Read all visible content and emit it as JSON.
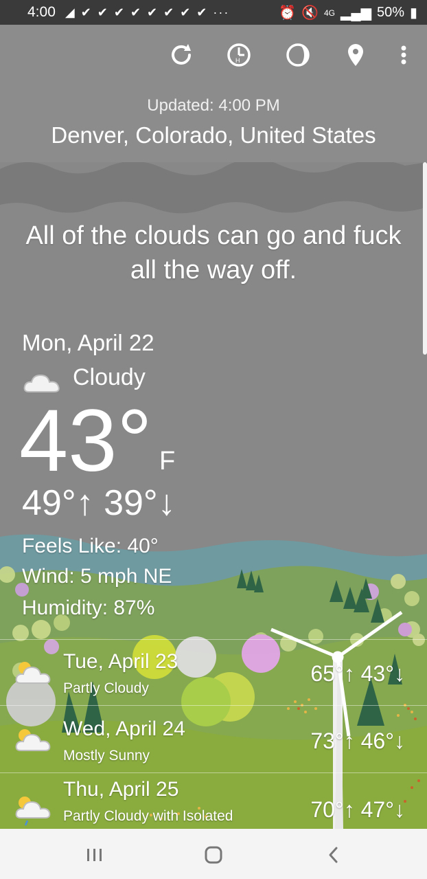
{
  "status_bar": {
    "time": "4:00",
    "network": "4G",
    "battery": "50%"
  },
  "toolbar": {
    "icons": [
      "refresh-icon",
      "history-icon",
      "moon-phase-icon",
      "location-pin-icon",
      "more-vert-icon"
    ]
  },
  "header": {
    "updated": "Updated: 4:00 PM",
    "location": "Denver, Colorado, United States"
  },
  "quote": "All of the clouds can go and fuck all the way off.",
  "current": {
    "date": "Mon, April 22",
    "condition": "Cloudy",
    "temp": "43°",
    "unit": "F",
    "hilo": "49°↑ 39°↓",
    "feels_like": "Feels Like: 40°",
    "wind": "Wind: 5 mph NE",
    "humidity": "Humidity: 87%"
  },
  "forecast": [
    {
      "day": "Tue, April 23",
      "condition": "Partly Cloudy",
      "temps": "65°↑ 43°↓",
      "icon": "partly-cloudy-icon"
    },
    {
      "day": "Wed, April 24",
      "condition": "Mostly Sunny",
      "temps": "73°↑ 46°↓",
      "icon": "mostly-sunny-icon"
    },
    {
      "day": "Thu, April 25",
      "condition": "Partly Cloudy with Isolated",
      "temps": "70°↑ 47°↓",
      "icon": "partly-cloudy-rain-icon"
    }
  ],
  "colors": {
    "sky": "#8a8a8a",
    "hills": "#7a9a55",
    "statusbar": "#3a3a3a"
  }
}
